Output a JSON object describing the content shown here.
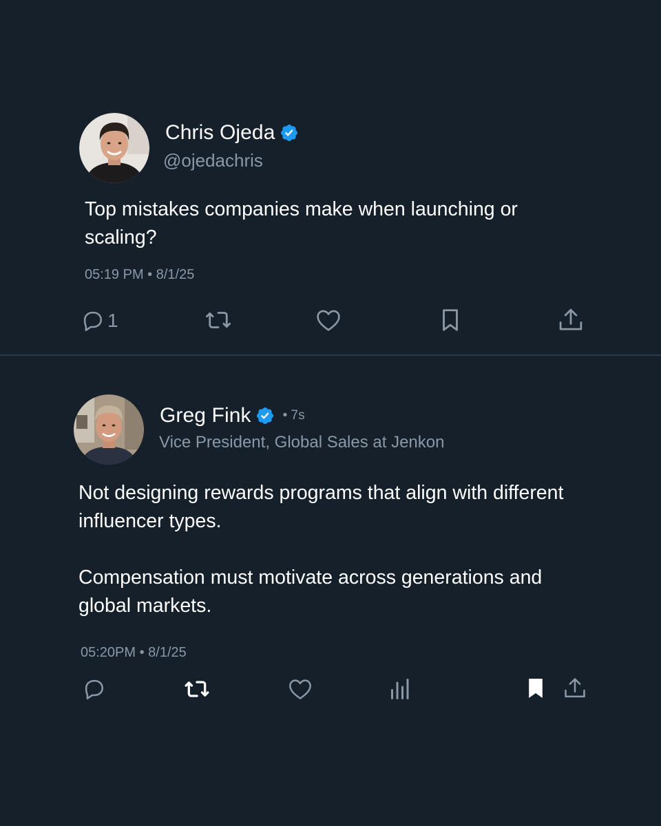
{
  "colors": {
    "background": "#16202b",
    "divider": "#2b3744",
    "text_primary": "#ffffff",
    "text_secondary": "#8b98a5",
    "verified_badge": "#1d9bf0"
  },
  "tweets": [
    {
      "author": {
        "display_name": "Chris Ojeda",
        "handle": "@ojedachris",
        "verified": true,
        "avatar_icon": "profile-photo"
      },
      "text": "Top mistakes companies make when launching or scaling?",
      "timestamp": "05:19 PM • 8/1/25",
      "actions": {
        "reply_count": "1",
        "icons": [
          "reply-icon",
          "retweet-icon",
          "like-icon",
          "bookmark-icon",
          "share-icon"
        ]
      }
    },
    {
      "author": {
        "display_name": "Greg Fink",
        "relative_time": "• 7s",
        "subtitle": "Vice President, Global Sales at Jenkon",
        "verified": true,
        "avatar_icon": "profile-photo"
      },
      "text": "Not designing rewards programs that align with different influencer types.\n\nCompensation must motivate across generations and global markets.",
      "timestamp": "05:20PM • 8/1/25",
      "actions": {
        "icons": [
          "reply-icon",
          "retweet-icon",
          "like-icon",
          "views-icon",
          "bookmark-filled-icon",
          "share-icon"
        ]
      }
    }
  ]
}
